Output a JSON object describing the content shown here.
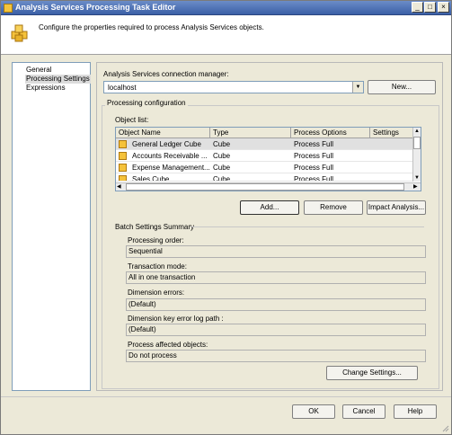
{
  "window": {
    "title": "Analysis Services Processing Task Editor",
    "controls": {
      "minimize": "_",
      "maximize": "□",
      "close": "×"
    }
  },
  "header": {
    "icon": "cube-stack-icon",
    "text": "Configure the properties required to process Analysis Services objects."
  },
  "nav": {
    "items": [
      {
        "label": "General",
        "selected": false
      },
      {
        "label": "Processing Settings",
        "selected": true
      },
      {
        "label": "Expressions",
        "selected": false
      }
    ]
  },
  "connection": {
    "label": "Analysis Services connection manager:",
    "value": "localhost",
    "new_button": "New..."
  },
  "processing": {
    "group_title": "Processing configuration",
    "object_list_label": "Object list:",
    "columns": [
      "Object Name",
      "Type",
      "Process Options",
      "Settings"
    ],
    "rows": [
      {
        "name": "General Ledger Cube",
        "type": "Cube",
        "options": "Process Full",
        "settings": ""
      },
      {
        "name": "Accounts Receivable ...",
        "type": "Cube",
        "options": "Process Full",
        "settings": ""
      },
      {
        "name": "Expense Management...",
        "type": "Cube",
        "options": "Process Full",
        "settings": ""
      },
      {
        "name": "Sales Cube",
        "type": "Cube",
        "options": "Process Full",
        "settings": ""
      }
    ],
    "buttons": {
      "add": "Add...",
      "remove": "Remove",
      "impact": "Impact Analysis..."
    }
  },
  "batch": {
    "title": "Batch Settings Summary",
    "fields": [
      {
        "label": "Processing order:",
        "value": "Sequential"
      },
      {
        "label": "Transaction mode:",
        "value": "All in one transaction"
      },
      {
        "label": "Dimension errors:",
        "value": "(Default)"
      },
      {
        "label": "Dimension key error log path :",
        "value": "(Default)"
      },
      {
        "label": "Process affected objects:",
        "value": "Do not process"
      }
    ],
    "change_button": "Change Settings..."
  },
  "footer": {
    "ok": "OK",
    "cancel": "Cancel",
    "help": "Help"
  },
  "colors": {
    "titlebar": "#3b5fa6",
    "cube": "#f5c23a",
    "dialog_bg": "#ece9d8"
  }
}
